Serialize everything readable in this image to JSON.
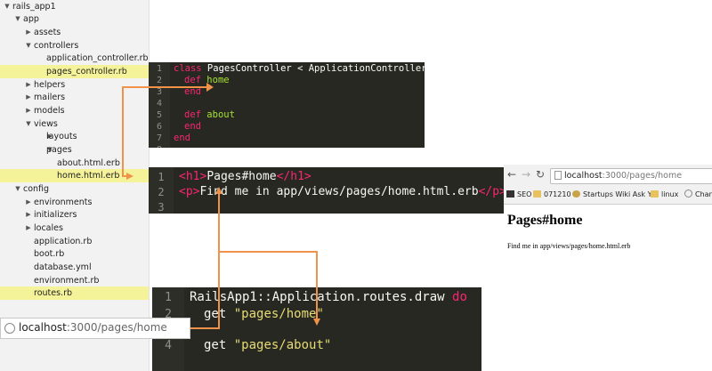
{
  "file_tree": {
    "items": [
      {
        "label": "rails_app1",
        "level": 0,
        "arrow": "▼",
        "highlight": false
      },
      {
        "label": "app",
        "level": 1,
        "arrow": "▼",
        "highlight": false
      },
      {
        "label": "assets",
        "level": 2,
        "arrow": "▶",
        "highlight": false
      },
      {
        "label": "controllers",
        "level": 2,
        "arrow": "▼",
        "highlight": false
      },
      {
        "label": "application_controller.rb",
        "level": 3,
        "arrow": "",
        "highlight": false
      },
      {
        "label": "pages_controller.rb",
        "level": 3,
        "arrow": "",
        "highlight": true
      },
      {
        "label": "helpers",
        "level": 2,
        "arrow": "▶",
        "highlight": false
      },
      {
        "label": "mailers",
        "level": 2,
        "arrow": "▶",
        "highlight": false
      },
      {
        "label": "models",
        "level": 2,
        "arrow": "▶",
        "highlight": false
      },
      {
        "label": "views",
        "level": 2,
        "arrow": "▼",
        "highlight": false
      },
      {
        "label": "layouts",
        "level": 3,
        "arrow": "▶",
        "highlight": false
      },
      {
        "label": "pages",
        "level": 3,
        "arrow": "▼",
        "highlight": false
      },
      {
        "label": "about.html.erb",
        "level": 4,
        "arrow": "",
        "highlight": false
      },
      {
        "label": "home.html.erb",
        "level": 4,
        "arrow": "",
        "highlight": true
      },
      {
        "label": "config",
        "level": 1,
        "arrow": "▼",
        "highlight": false
      },
      {
        "label": "environments",
        "level": 2,
        "arrow": "▶",
        "highlight": false
      },
      {
        "label": "initializers",
        "level": 2,
        "arrow": "▶",
        "highlight": false
      },
      {
        "label": "locales",
        "level": 2,
        "arrow": "▶",
        "highlight": false
      },
      {
        "label": "application.rb",
        "level": 2,
        "arrow": "",
        "highlight": false
      },
      {
        "label": "boot.rb",
        "level": 2,
        "arrow": "",
        "highlight": false
      },
      {
        "label": "database.yml",
        "level": 2,
        "arrow": "",
        "highlight": false
      },
      {
        "label": "environment.rb",
        "level": 2,
        "arrow": "",
        "highlight": false
      },
      {
        "label": "routes.rb",
        "level": 2,
        "arrow": "",
        "highlight": true
      }
    ]
  },
  "controller_editor": {
    "line_numbers": [
      "1",
      "2",
      "3",
      "4",
      "5",
      "6",
      "7",
      "8"
    ],
    "lines": {
      "l1_kw": "class",
      "l1_name": " PagesController",
      "l1_rest": " < ApplicationController",
      "l2_kw": "def",
      "l2_name": "home",
      "l3": "end",
      "l5_kw": "def",
      "l5_name": "about",
      "l6": "end",
      "l8": "end"
    }
  },
  "view_editor": {
    "line_numbers": [
      "1",
      "2",
      "3"
    ],
    "lines": {
      "l1_open": "<h1>",
      "l1_text": "Pages#home",
      "l1_close": "</h1>",
      "l2_open": "<p>",
      "l2_text": "Find me in app/views/pages/home.html.erb",
      "l2_close": "</p>"
    }
  },
  "routes_editor": {
    "line_numbers": [
      "1",
      "2",
      "3",
      "4"
    ],
    "lines": {
      "l1_name": "RailsApp1::Application.routes.draw",
      "l1_kw": "do",
      "l2_kw": "get",
      "l2_str": "\"pages/home\"",
      "l4_kw": "get",
      "l4_str": "\"pages/about\""
    }
  },
  "browser": {
    "url_host": "localhost",
    "url_path": ":3000/pages/home",
    "bookmarks": [
      "SEO",
      "071210",
      "Startups Wiki Ask Y...",
      "linux",
      "Channe"
    ],
    "page_heading": "Pages#home",
    "page_paragraph": "Find me in app/views/pages/home.html.erb"
  },
  "url_bar": {
    "host": "localhost",
    "path": ":3000/pages/home"
  },
  "colors": {
    "highlight": "#f5f39a",
    "editor_bg": "#272822",
    "arrow": "#f0924a"
  }
}
